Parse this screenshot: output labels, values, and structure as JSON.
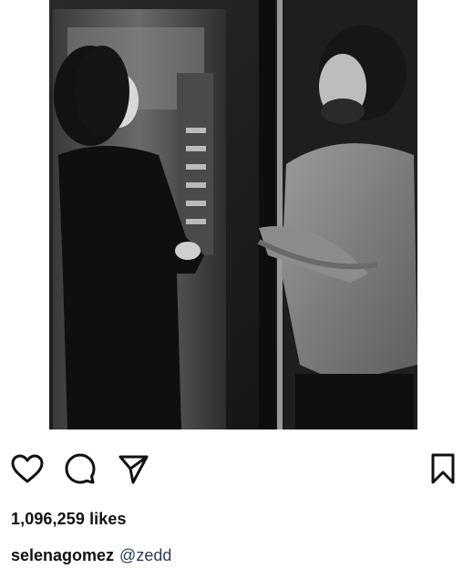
{
  "post": {
    "photo_icon": "photo-image",
    "likes_text": "1,096,259 likes",
    "caption": {
      "username": "selenagomez",
      "mention": "@zedd"
    }
  },
  "actions": {
    "like_icon": "heart-outline-icon",
    "comment_icon": "comment-bubble-icon",
    "share_icon": "send-paper-plane-icon",
    "save_icon": "bookmark-outline-icon"
  },
  "colors": {
    "text": "#111111",
    "mention": "#2c3a57",
    "photo_dark": "#1b1b1b"
  }
}
